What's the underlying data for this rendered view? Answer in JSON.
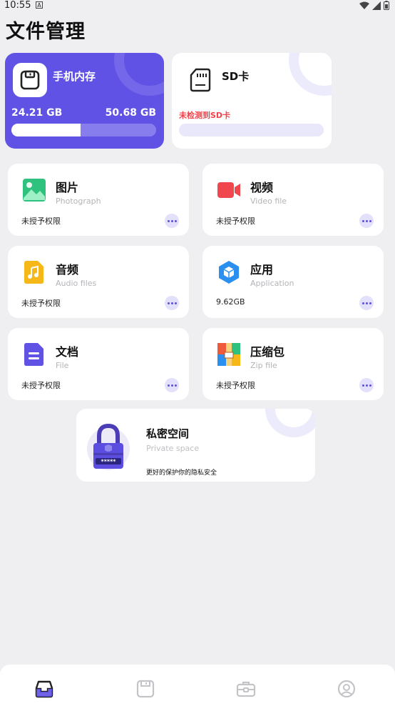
{
  "status_bar": {
    "time": "10:55",
    "notification_letter": "A"
  },
  "page": {
    "title": "文件管理"
  },
  "phone_storage": {
    "name": "手机内存",
    "used": "24.21 GB",
    "total": "50.68 GB",
    "used_fraction": 0.48
  },
  "sd_storage": {
    "name": "SD卡",
    "status": "未检测到SD卡",
    "used_fraction": 0
  },
  "categories": [
    {
      "name": "图片",
      "subtitle": "Photograph",
      "status": "未授予权限",
      "icon": "image-icon",
      "color": "#2ec27e"
    },
    {
      "name": "视频",
      "subtitle": "Video file",
      "status": "未授予权限",
      "icon": "video-camera-icon",
      "color": "#f0474f"
    },
    {
      "name": "音频",
      "subtitle": "Audio files",
      "status": "未授予权限",
      "icon": "music-icon",
      "color": "#f6b718"
    },
    {
      "name": "应用",
      "subtitle": "Application",
      "status": "9.62GB",
      "icon": "app-cube-icon",
      "color": "#2b8ff0"
    },
    {
      "name": "文档",
      "subtitle": "File",
      "status": "未授予权限",
      "icon": "document-icon",
      "color": "#6152e6"
    },
    {
      "name": "压缩包",
      "subtitle": "Zip file",
      "status": "未授予权限",
      "icon": "zip-archive-icon",
      "color": "#f05a3c"
    }
  ],
  "private_space": {
    "name": "私密空间",
    "subtitle": "Private space",
    "description": "更好的保护你的隐私安全",
    "password_mask": "*****"
  },
  "bottom_nav": [
    {
      "icon": "inbox-icon",
      "active": true
    },
    {
      "icon": "floppy-disk-icon",
      "active": false
    },
    {
      "icon": "toolbox-icon",
      "active": false
    },
    {
      "icon": "user-circle-icon",
      "active": false
    }
  ],
  "colors": {
    "accent": "#6152e6",
    "background": "#efeff1",
    "error": "#f0424a"
  }
}
